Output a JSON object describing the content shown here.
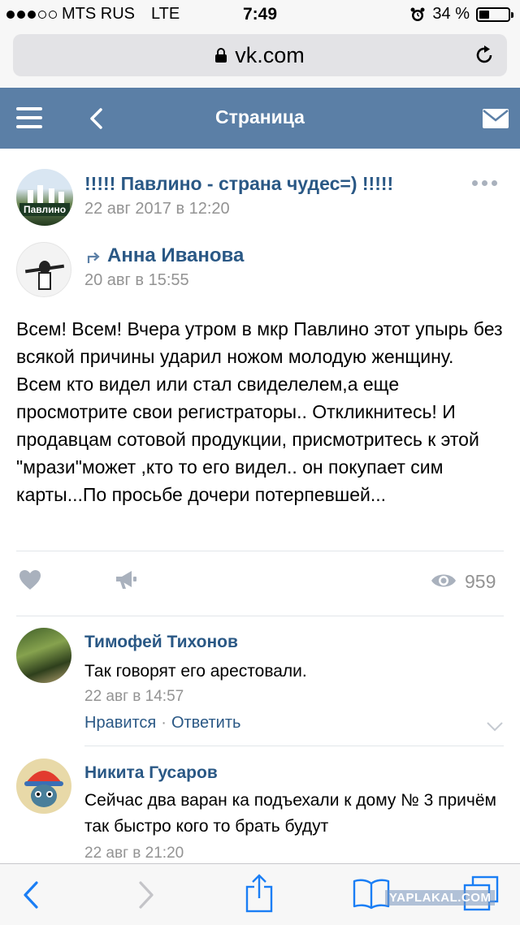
{
  "status_bar": {
    "carrier": "MTS RUS",
    "network": "LTE",
    "time": "7:49",
    "battery": "34 %",
    "battery_level": 0.34
  },
  "browser": {
    "url": "vk.com"
  },
  "header": {
    "title": "Страница"
  },
  "post": {
    "group_name": "!!!!! Павлино - страна чудес=) !!!!!",
    "group_date": "22 авг 2017 в 12:20",
    "group_avatar_text": "Павлино",
    "author_name": "Анна Иванова",
    "author_date": "20 авг в 15:55",
    "text": "Всем! Всем! Вчера утром в мкр Павлино этот упырь без всякой причины ударил ножом молодую женщину. Всем кто видел или стал свиделелем,а еще просмотрите свои регистраторы.. Откликнитесь! И продавцам сотовой продукции, присмотритесь к этой \"мрази\"может ,кто то его видел.. он покупает сим карты...По просьбе дочери потерпевшей...",
    "views": "959"
  },
  "comments": [
    {
      "name": "Тимофей Тихонов",
      "text": "Так говорят его арестовали.",
      "date": "22 авг в 14:57",
      "like_label": "Нравится",
      "reply_label": "Ответить"
    },
    {
      "name": "Никита Гусаров",
      "text": "Сейчас два варан ка подъехали к дому № 3 причём так быстро кого то брать будут",
      "date": "22 авг в 21:20"
    }
  ],
  "watermark": "YAPLAKAL.COM",
  "icons": [
    "menu-icon",
    "back-icon",
    "mail-icon",
    "more-icon",
    "repost-icon",
    "like-icon",
    "share-icon",
    "views-icon",
    "chevron-down-icon",
    "safari-back-icon",
    "safari-forward-icon",
    "share-sheet-icon",
    "bookmarks-icon",
    "tabs-icon"
  ],
  "colors": {
    "vk_header": "#5b7fa6",
    "link": "#2a5885",
    "muted": "#939393",
    "safari_blue": "#1a7ef5"
  }
}
